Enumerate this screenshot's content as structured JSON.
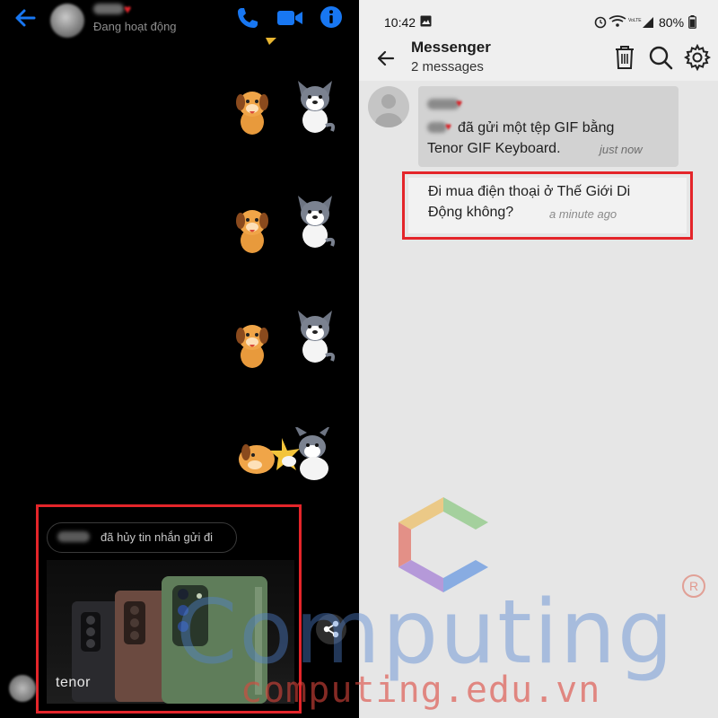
{
  "left": {
    "contact_status": "Đang hoạt động",
    "unsent_notice": "đã hủy tin nhắn gửi đi",
    "gif_brand": "tenor",
    "accent_color": "#1877f2",
    "icons": [
      "back-arrow-icon",
      "phone-icon",
      "video-camera-icon",
      "info-icon",
      "share-icon"
    ]
  },
  "right": {
    "status_bar": {
      "time": "10:42",
      "battery": "80%"
    },
    "header": {
      "title": "Messenger",
      "subtitle": "2 messages",
      "icons": [
        "back-arrow-icon",
        "trash-icon",
        "search-icon",
        "gear-icon"
      ]
    },
    "messages": [
      {
        "text_line1": "đã gửi một tệp GIF bằng",
        "text_line2": "Tenor GIF Keyboard.",
        "time": "just now"
      },
      {
        "text_line1": "Đi mua điện thoại ở Thế Giới Di",
        "text_line2": "Động không?",
        "time": "a minute ago"
      }
    ]
  },
  "watermark": {
    "word": "Computing",
    "url": "computing.edu.vn",
    "registered_mark": "R"
  },
  "colors": {
    "highlight_red": "#e4252a"
  }
}
